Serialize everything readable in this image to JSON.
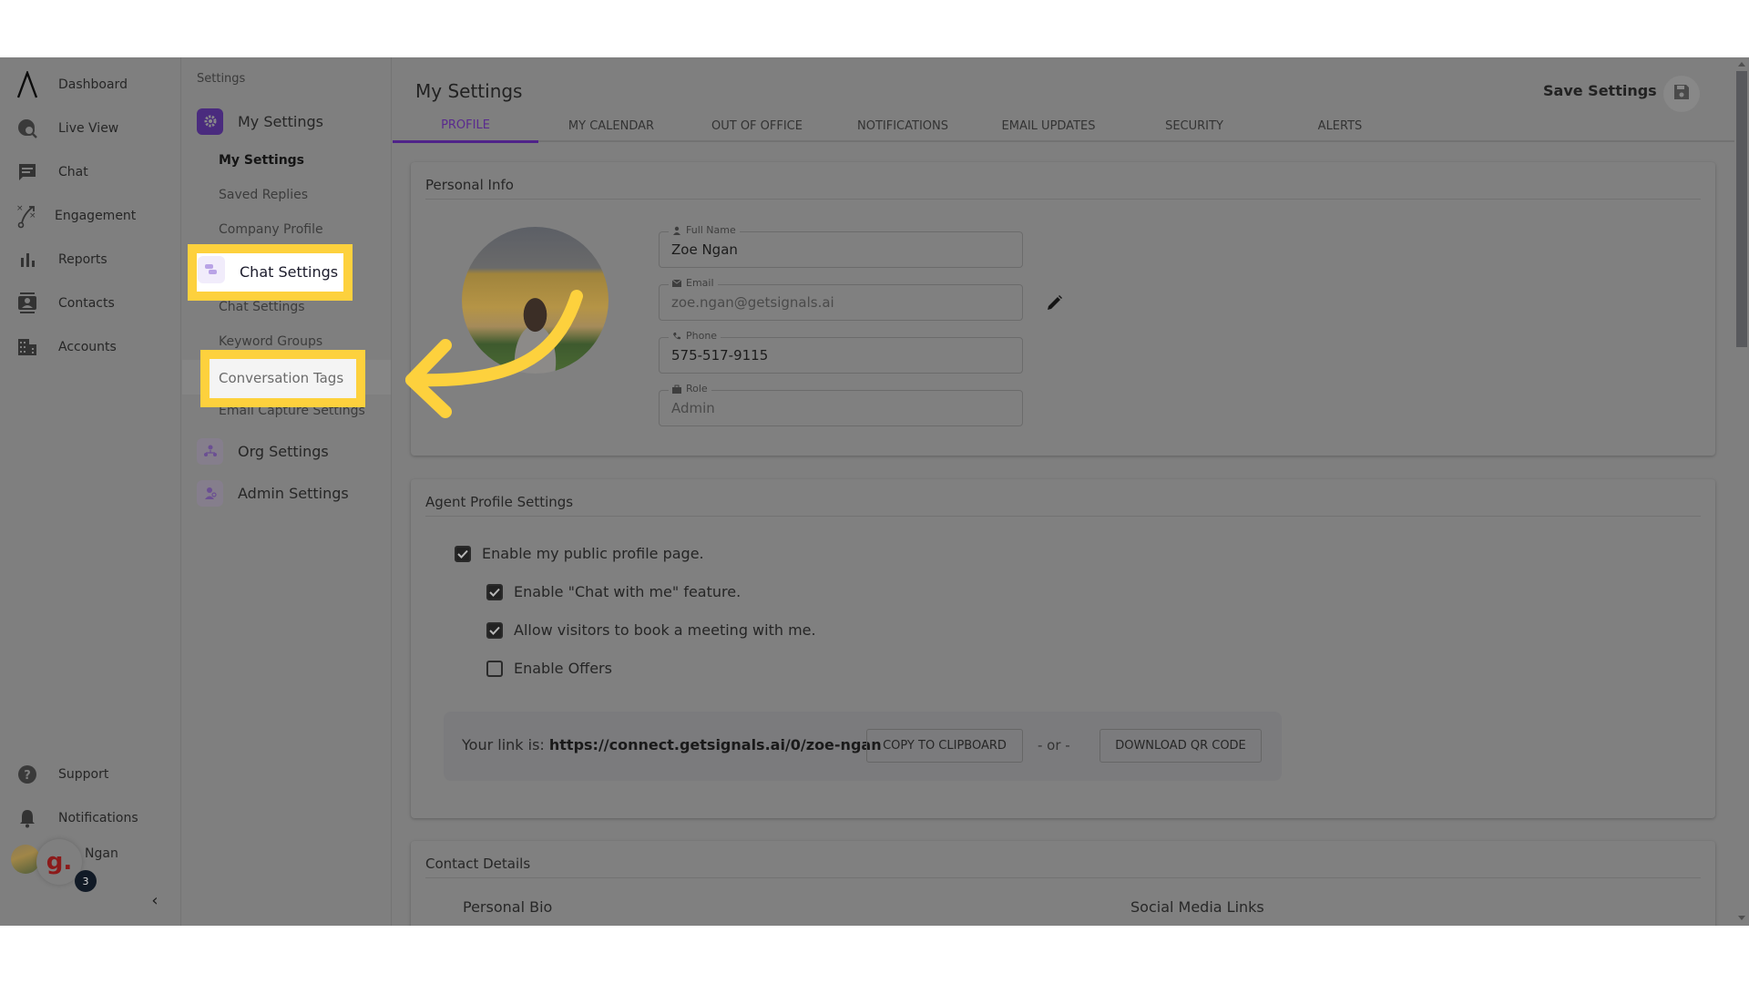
{
  "nav": {
    "items": [
      {
        "label": "Dashboard",
        "icon": "logo-icon"
      },
      {
        "label": "Live View",
        "icon": "globe-search-icon"
      },
      {
        "label": "Chat",
        "icon": "chat-icon"
      },
      {
        "label": "Engagement",
        "icon": "strategy-icon"
      },
      {
        "label": "Reports",
        "icon": "bar-chart-icon"
      },
      {
        "label": "Contacts",
        "icon": "contact-card-icon"
      },
      {
        "label": "Accounts",
        "icon": "building-icon"
      }
    ],
    "bottom": [
      {
        "label": "Support",
        "icon": "help-icon"
      },
      {
        "label": "Notifications",
        "icon": "bell-icon"
      }
    ],
    "user_name": "Ngan",
    "bubble_letter": "g.",
    "bubble_badge": "3",
    "collapse_glyph": "‹"
  },
  "subnav": {
    "title": "Settings",
    "groups": [
      {
        "label": "My Settings",
        "icon": "gear-icon",
        "items": [
          "My Settings",
          "Saved Replies",
          "Company Profile"
        ],
        "active_item": "My Settings"
      },
      {
        "label": "Chat Settings",
        "icon": "chat-bubbles-icon",
        "items": [
          "Chat Settings",
          "Keyword Groups",
          "Conversation Tags",
          "Email Capture Settings"
        ]
      },
      {
        "label": "Org Settings",
        "icon": "org-icon",
        "items": []
      },
      {
        "label": "Admin Settings",
        "icon": "admin-icon",
        "items": []
      }
    ]
  },
  "header": {
    "title": "My Settings",
    "save_label": "Save Settings",
    "save_icon": "floppy-disk-icon"
  },
  "tabs": [
    {
      "label": "PROFILE",
      "active": true
    },
    {
      "label": "MY CALENDAR",
      "active": false
    },
    {
      "label": "OUT OF OFFICE",
      "active": false
    },
    {
      "label": "NOTIFICATIONS",
      "active": false
    },
    {
      "label": "EMAIL UPDATES",
      "active": false
    },
    {
      "label": "SECURITY",
      "active": false
    },
    {
      "label": "ALERTS",
      "active": false
    }
  ],
  "personal_info": {
    "title": "Personal Info",
    "fields": [
      {
        "label": "Full Name",
        "value": "Zoe Ngan",
        "icon": "person-icon"
      },
      {
        "label": "Email",
        "value": "zoe.ngan@getsignals.ai",
        "icon": "mail-icon"
      },
      {
        "label": "Phone",
        "value": "575-517-9115",
        "icon": "phone-icon"
      },
      {
        "label": "Role",
        "value": "Admin",
        "icon": "briefcase-icon"
      }
    ]
  },
  "agent_profile": {
    "title": "Agent Profile Settings",
    "checkboxes": [
      {
        "label": "Enable my public profile page.",
        "checked": true
      },
      {
        "label": "Enable \"Chat with me\" feature.",
        "checked": true
      },
      {
        "label": "Allow visitors to book a meeting with me.",
        "checked": true
      },
      {
        "label": "Enable Offers",
        "checked": false
      }
    ],
    "link_prefix": "Your link is:",
    "link_url": "https://connect.getsignals.ai/0/zoe-ngan",
    "copy_label": "COPY TO CLIPBOARD",
    "or_label": "- or -",
    "qr_label": "DOWNLOAD QR CODE"
  },
  "contact_details": {
    "title": "Contact Details",
    "personal_bio": "Personal Bio",
    "social_links": "Social Media Links"
  },
  "colors": {
    "accent": "#4f2389",
    "highlight": "#fdd13d",
    "overlay": "#7f7f7f"
  }
}
